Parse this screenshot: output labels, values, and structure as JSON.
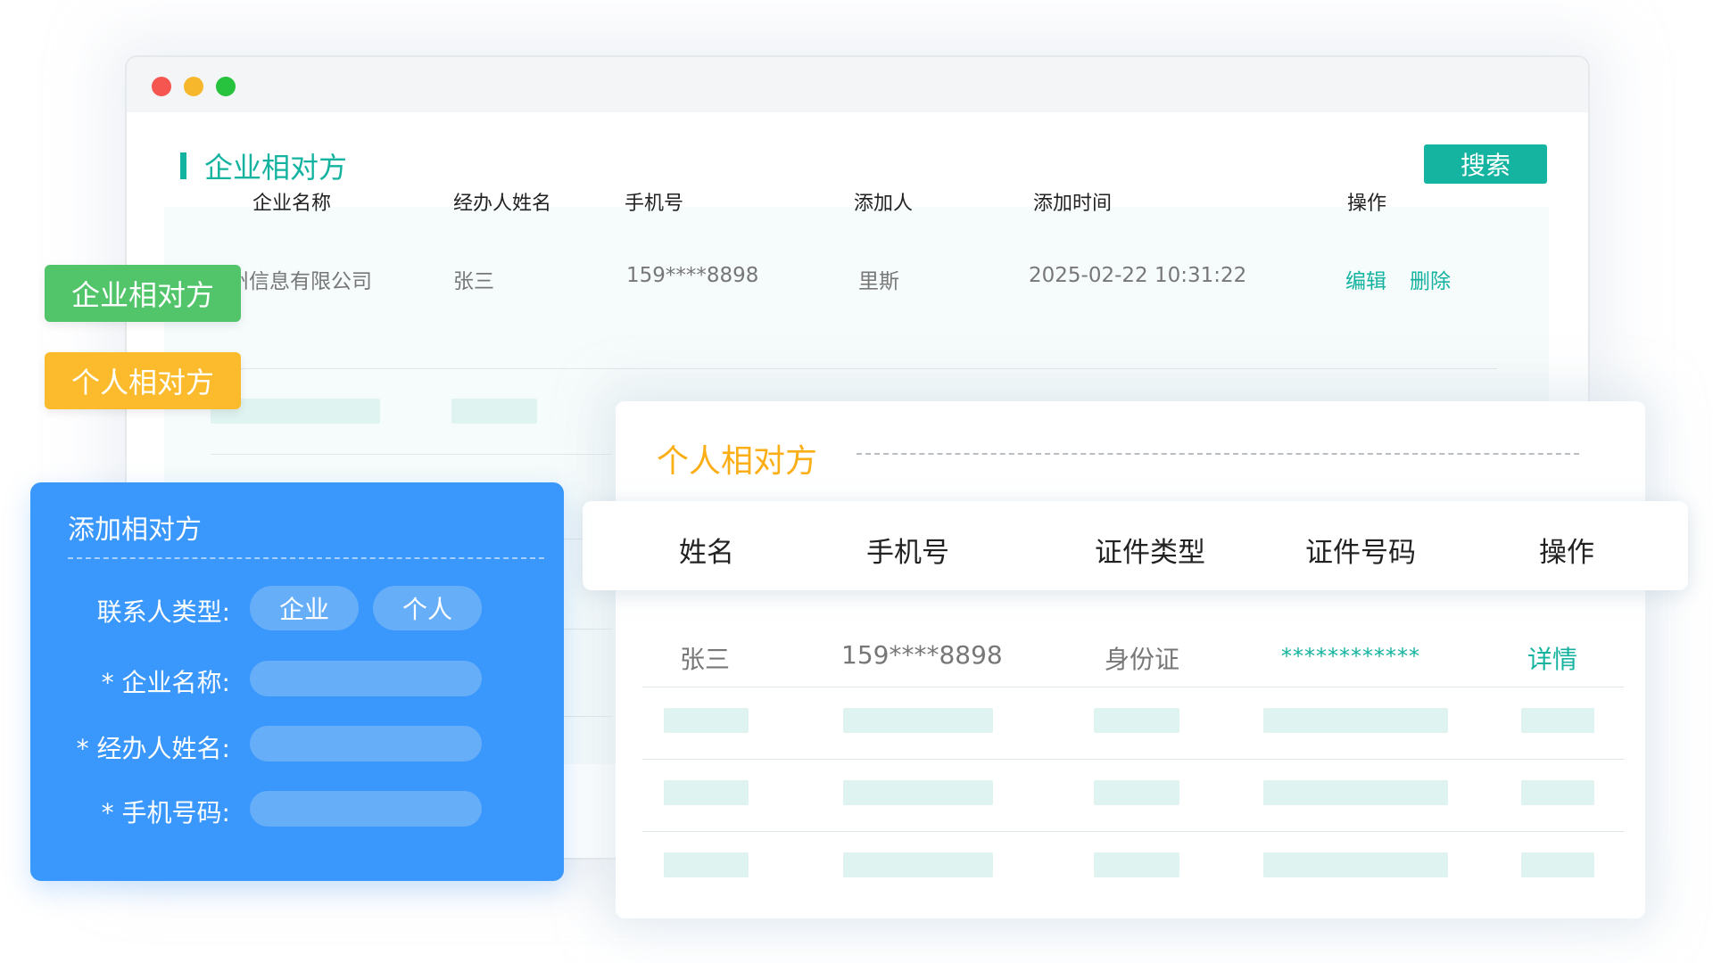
{
  "window": {
    "section_title": "企业相对方",
    "search_label": "搜索",
    "table": {
      "headers": [
        "企业名称",
        "经办人姓名",
        "手机号",
        "添加人",
        "添加时间",
        "操作"
      ],
      "row": {
        "company": "广州信息有限公司",
        "operator": "张三",
        "phone": "159****8898",
        "added_by": "里斯",
        "added_time": "2025-02-22 10:31:22",
        "edit_label": "编辑",
        "delete_label": "删除"
      }
    }
  },
  "tags": {
    "company": "企业相对方",
    "personal": "个人相对方"
  },
  "form": {
    "title": "添加相对方",
    "type_label": "联系人类型:",
    "type_options": [
      "企业",
      "个人"
    ],
    "company_label": "* 企业名称:",
    "operator_label": "* 经办人姓名:",
    "phone_label": "* 手机号码:"
  },
  "personal_card": {
    "title": "个人相对方",
    "headers": [
      "姓名",
      "手机号",
      "证件类型",
      "证件号码",
      "操作"
    ],
    "row": {
      "name": "张三",
      "phone": "159****8898",
      "id_type": "身份证",
      "id_number": "************",
      "detail_label": "详情"
    }
  },
  "colors": {
    "teal": "#14b3a0",
    "green": "#52c46a",
    "yellow": "#fbbb2c",
    "blue": "#3a97fb",
    "orange_title": "#fcae17"
  }
}
